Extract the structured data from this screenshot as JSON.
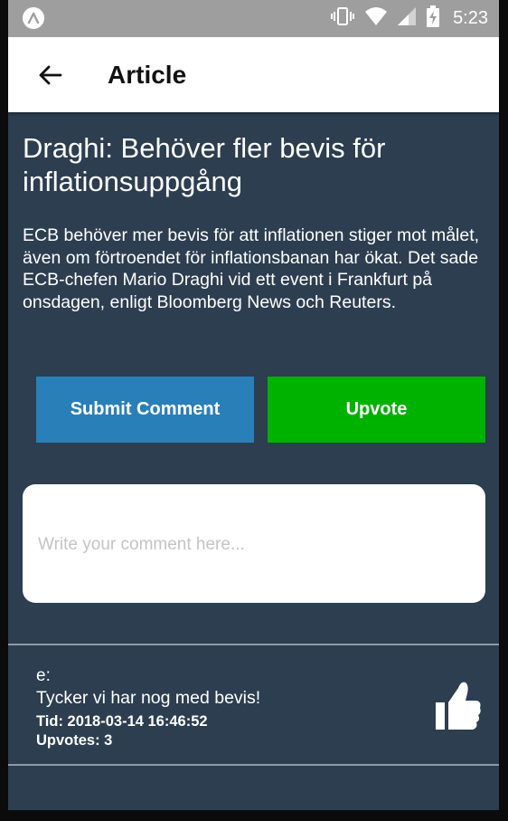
{
  "status_bar": {
    "time": "5:23",
    "icons": [
      "app-logo-icon",
      "vibrate-icon",
      "wifi-icon",
      "signal-icon",
      "battery-charging-icon"
    ]
  },
  "app_bar": {
    "title": "Article",
    "back_icon": "arrow-left-icon"
  },
  "article": {
    "title": "Draghi: Behöver fler bevis för inflationsuppgång",
    "body": "ECB behöver mer bevis för att inflationen stiger mot målet, även om förtroendet för inflationsbanan har ökat.  Det sade ECB-chefen Mario Draghi vid ett event i Frankfurt på onsdagen, enligt Bloomberg News och Reuters."
  },
  "actions": {
    "submit_label": "Submit Comment",
    "upvote_label": "Upvote"
  },
  "comment_input": {
    "placeholder": "Write your comment here...",
    "value": ""
  },
  "comments": [
    {
      "author": "e:",
      "text": "Tycker vi har nog med bevis!",
      "time": "Tid: 2018-03-14 16:46:52",
      "upvotes": "Upvotes: 3",
      "icon": "thumbs-up-icon"
    }
  ],
  "colors": {
    "background": "#2c3e50",
    "submit_button": "#2980b9",
    "upvote_button": "#00b200",
    "status_bar": "#9e9e9e",
    "app_bar": "#ffffff"
  }
}
